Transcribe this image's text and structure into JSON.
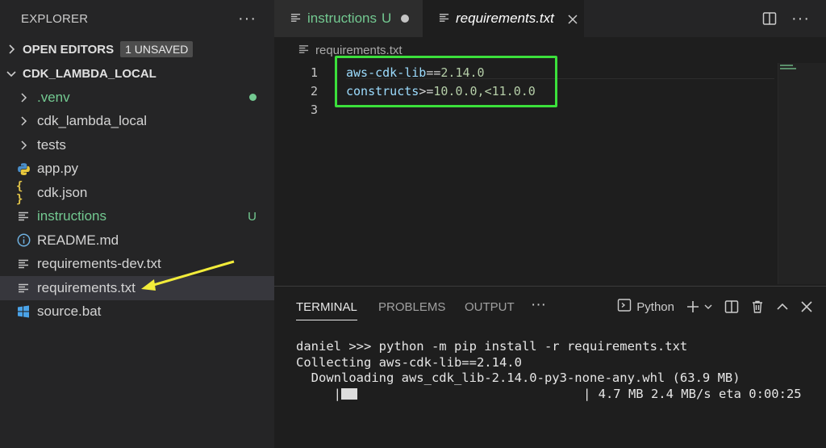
{
  "sidebar": {
    "title": "EXPLORER",
    "open_editors": {
      "label": "OPEN EDITORS",
      "badge": "1 UNSAVED"
    },
    "project": {
      "label": "CDK_LAMBDA_LOCAL"
    },
    "items": [
      {
        "label": ".venv",
        "kind": "folder",
        "icon": "chevron-right-icon",
        "status": "modified-dot"
      },
      {
        "label": "cdk_lambda_local",
        "kind": "folder",
        "icon": "chevron-right-icon"
      },
      {
        "label": "tests",
        "kind": "folder",
        "icon": "chevron-right-icon"
      },
      {
        "label": "app.py",
        "kind": "file",
        "icon": "python-icon"
      },
      {
        "label": "cdk.json",
        "kind": "file",
        "icon": "json-braces-icon"
      },
      {
        "label": "instructions",
        "kind": "file",
        "icon": "text-lines-icon",
        "status": "U"
      },
      {
        "label": "README.md",
        "kind": "file",
        "icon": "info-icon"
      },
      {
        "label": "requirements-dev.txt",
        "kind": "file",
        "icon": "text-lines-icon"
      },
      {
        "label": "requirements.txt",
        "kind": "file",
        "icon": "text-lines-icon",
        "selected": true
      },
      {
        "label": "source.bat",
        "kind": "file",
        "icon": "windows-icon"
      }
    ]
  },
  "tabs": [
    {
      "label": "instructions",
      "status": "U",
      "unsaved": true
    },
    {
      "label": "requirements.txt",
      "active": true
    }
  ],
  "breadcrumb": "requirements.txt",
  "editor": {
    "lines": [
      {
        "number": "1",
        "name": "aws-cdk-lib",
        "op": "==",
        "version": "2.14.0"
      },
      {
        "number": "2",
        "name": "constructs",
        "op": ">=",
        "version": "10.0.0,<11.0.0"
      },
      {
        "number": "3",
        "name": "",
        "op": "",
        "version": ""
      }
    ]
  },
  "panel": {
    "tabs": [
      "TERMINAL",
      "PROBLEMS",
      "OUTPUT"
    ],
    "active_tab": "TERMINAL",
    "terminal_name": "Python",
    "terminal_lines": [
      "daniel >>> python -m pip install -r requirements.txt",
      "Collecting aws-cdk-lib==2.14.0",
      "  Downloading aws_cdk_lib-2.14.0-py3-none-any.whl (63.9 MB)",
      "| 4.7 MB 2.4 MB/s eta 0:00:25"
    ]
  },
  "colors": {
    "annotation_box": "#3be03b",
    "annotation_arrow": "#f2ec3a",
    "git_untracked": "#73c991"
  }
}
